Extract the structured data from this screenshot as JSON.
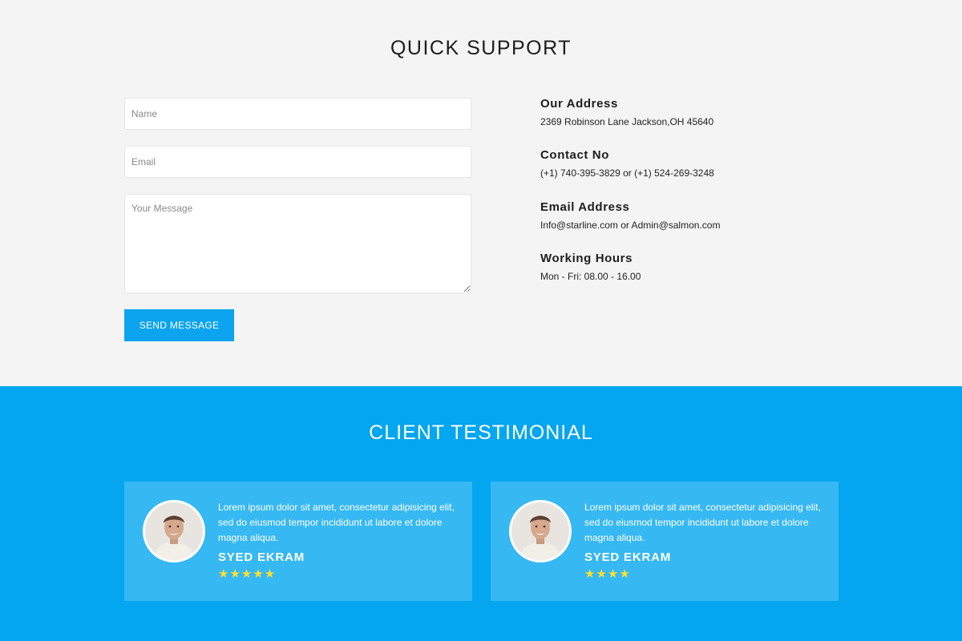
{
  "quick_support": {
    "title": "QUICK SUPPORT",
    "form": {
      "name_placeholder": "Name",
      "email_placeholder": "Email",
      "message_placeholder": "Your Message",
      "send_label": "SEND MESSAGE"
    },
    "contact_info": [
      {
        "heading": "Our Address",
        "value": "2369 Robinson Lane Jackson,OH 45640"
      },
      {
        "heading": "Contact No",
        "value": "(+1) 740-395-3829 or (+1) 524-269-3248"
      },
      {
        "heading": "Email Address",
        "value": "Info@starline.com or Admin@salmon.com"
      },
      {
        "heading": "Working Hours",
        "value": "Mon - Fri: 08.00 - 16.00"
      }
    ]
  },
  "testimonials": {
    "title": "CLIENT TESTIMONIAL",
    "items": [
      {
        "quote": "Lorem ipsum dolor sit amet, consectetur adipisicing elit, sed do eiusmod tempor incididunt ut labore et dolore magna aliqua.",
        "name": "SYED EKRAM",
        "rating": 5,
        "stars": "★★★★★"
      },
      {
        "quote": "Lorem ipsum dolor sit amet, consectetur adipisicing elit, sed do eiusmod tempor incididunt ut labore et dolore magna aliqua.",
        "name": "SYED EKRAM",
        "rating": 4,
        "stars": "★★★★"
      }
    ]
  },
  "colors": {
    "accent": "#0ca4ee",
    "testimonial_bg": "#05a6f0",
    "card_bg": "#36b8f3",
    "star": "#ffe02b",
    "section_bg": "#f4f4f4"
  },
  "icons": [
    "avatar-photo",
    "star-icon",
    "resize-grip-icon"
  ]
}
